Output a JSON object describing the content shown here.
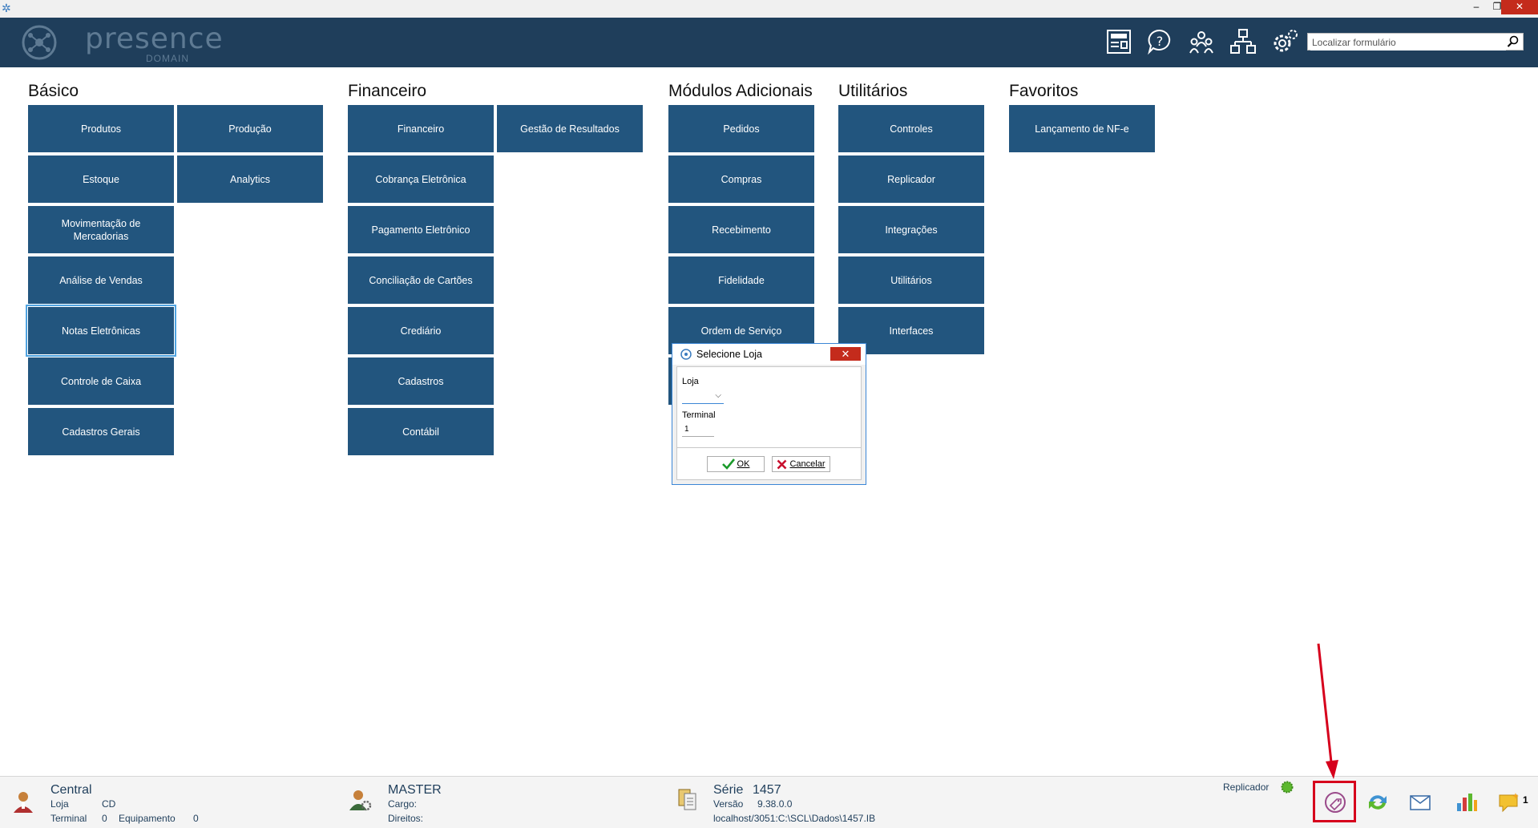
{
  "window": {
    "minimize": "–",
    "restore": "❐",
    "close": "✕"
  },
  "header": {
    "logo_text": "presence",
    "logo_sub": "DOMAIN",
    "icons": [
      "news-icon",
      "help-icon",
      "users-icon",
      "network-icon",
      "settings-icon"
    ],
    "search_placeholder": "Localizar formulário"
  },
  "groups": {
    "basico": {
      "title": "Básico",
      "tiles": [
        "Produtos",
        "Produção",
        "Estoque",
        "Analytics",
        "Movimentação de Mercadorias",
        "Análise de Vendas",
        "Notas Eletrônicas",
        "Controle de Caixa",
        "Cadastros Gerais"
      ]
    },
    "financeiro": {
      "title": "Financeiro",
      "tiles": [
        "Financeiro",
        "Gestão de Resultados",
        "Cobrança Eletrônica",
        "Pagamento Eletrônico",
        "Conciliação de Cartões",
        "Crediário",
        "Cadastros",
        "Contábil"
      ]
    },
    "modulos": {
      "title": "Módulos Adicionais",
      "tiles": [
        "Pedidos",
        "Compras",
        "Recebimento",
        "Fidelidade",
        "Ordem de Serviço"
      ]
    },
    "utilitarios": {
      "title": "Utilitários",
      "tiles": [
        "Controles",
        "Replicador",
        "Integrações",
        "Utilitários",
        "Interfaces"
      ]
    },
    "favoritos": {
      "title": "Favoritos",
      "tiles": [
        "Lançamento de NF-e"
      ]
    }
  },
  "dialog": {
    "title": "Selecione Loja",
    "close": "✕",
    "loja_label": "Loja",
    "loja_value": "",
    "terminal_label": "Terminal",
    "terminal_value": "1",
    "ok_label": "OK",
    "cancel_label": "Cancelar"
  },
  "status": {
    "central": "Central",
    "loja_label": "Loja",
    "loja_value": "CD",
    "terminal_label": "Terminal",
    "terminal_value": "0",
    "equipamento_label": "Equipamento",
    "equipamento_value": "0",
    "user": "MASTER",
    "cargo_label": "Cargo:",
    "direitos_label": "Direitos:",
    "serie_label": "Série",
    "serie_value": "1457",
    "versao_label": "Versão",
    "versao_value": "9.38.0.0",
    "db_path": "localhost/3051:C:\\SCL\\Dados\\1457.IB",
    "replicador_label": "Replicador",
    "notification_count": "1"
  },
  "colors": {
    "header_bg": "#1f3e5b",
    "tile_bg": "#22557e",
    "highlight_red": "#d6001c",
    "replicador_status": "#5cb82e"
  }
}
